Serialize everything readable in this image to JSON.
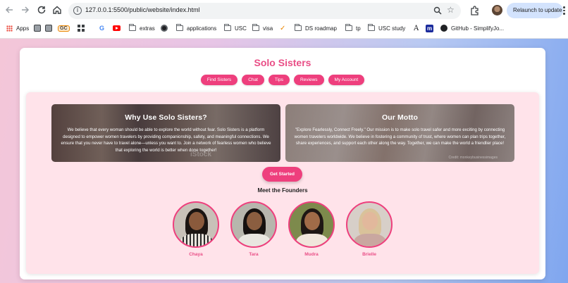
{
  "browser": {
    "url": "127.0.0.1:5500/public/website/index.html",
    "relaunch_label": "Relaunch to update",
    "bookmarks": [
      "Apps",
      "GC",
      "extras",
      "applications",
      "USC",
      "visa",
      "DS roadmap",
      "tp",
      "USC study",
      "GitHub - SimplifyJo..."
    ]
  },
  "site": {
    "title": "Solo Sisters",
    "nav": [
      "Find Sisters",
      "Chat",
      "Tips",
      "Reviews",
      "My Account"
    ],
    "why": {
      "heading": "Why Use Solo Sisters?",
      "body": "We believe that every woman should be able to explore the world without fear. Solo Sisters is a platform designed to empower women travelers by providing companionship, safety, and meaningful connections. We ensure that you never have to travel alone—unless you want to. Join a network of fearless women who believe that exploring the world is better when done together!",
      "watermark": "iStock"
    },
    "motto": {
      "heading": "Our Motto",
      "body": "\"Explore Fearlessly, Connect Freely.\" Our mission is to make solo travel safer and more exciting by connecting women travelers worldwide. We believe in fostering a community of trust, where women can plan trips together, share experiences, and support each other along the way. Together, we can make the world a friendlier place!",
      "credit": "Credit: monkeybusinessimages"
    },
    "cta": "Get Started",
    "founders_title": "Meet the Founders",
    "founders": [
      {
        "name": "Chaya"
      },
      {
        "name": "Tara"
      },
      {
        "name": "Mudra"
      },
      {
        "name": "Brielle"
      }
    ]
  },
  "colors": {
    "accent": "#ee3f7d",
    "title": "#e94e86",
    "panel": "#ffe3ea"
  }
}
